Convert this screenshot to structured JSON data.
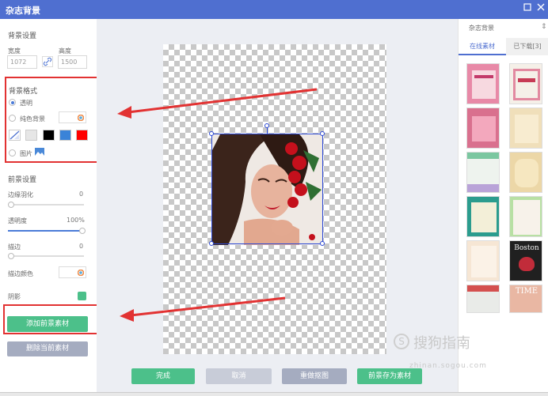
{
  "window": {
    "title": "杂志背景"
  },
  "left": {
    "bg_settings_title": "背景设置",
    "width_label": "宽度",
    "height_label": "高度",
    "width_value": "1072",
    "height_value": "1500",
    "bg_format_title": "背景格式",
    "transparent_label": "透明",
    "solid_label": "纯色背景",
    "image_label": "图片",
    "swatch_colors": [
      "#ffffff",
      "#e6e6e6",
      "#000000",
      "#3a83d8",
      "#ff0000"
    ],
    "fg_settings_title": "前景设置",
    "feather_label": "边缘羽化",
    "feather_value": "0",
    "opacity_label": "透明度",
    "opacity_value": "100%",
    "stroke_label": "描边",
    "stroke_value": "0",
    "stroke_color_label": "描边颜色",
    "shadow_label": "阴影",
    "add_fg_button": "添加前景素材",
    "delete_fg_button": "删除当前素材"
  },
  "bottom_buttons": {
    "done": "完成",
    "cancel": "取消",
    "redo_cutout": "重做抠图",
    "save_fg": "前景存为素材"
  },
  "right": {
    "title": "杂志背景",
    "tab_online": "在线素材",
    "tab_downloaded": "已下载[3]",
    "thumb_texts": [
      "Boston",
      "TIME"
    ]
  },
  "watermark": {
    "brand": "搜狗指南",
    "url": "zhinan.sogou.com"
  },
  "colors": {
    "titlebar": "#4f6fd0",
    "green": "#4cc08a",
    "gray_button": "#a5acc0",
    "red_annotation": "#e23232",
    "selection": "#2b48d6"
  }
}
